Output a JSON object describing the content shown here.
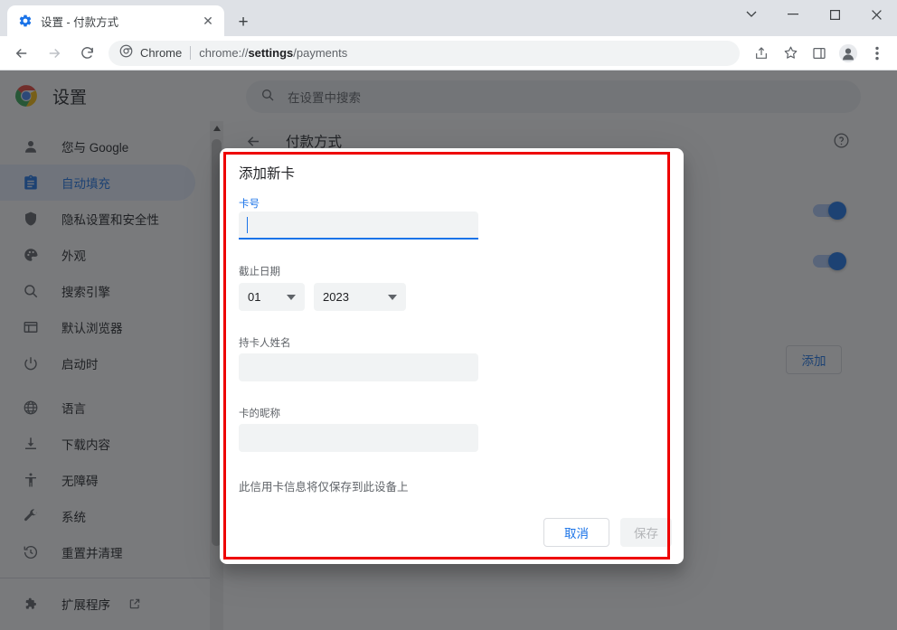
{
  "window": {
    "controls": [
      {
        "name": "tab-search",
        "glyph": "⌄"
      },
      {
        "name": "minimize",
        "glyph": "−"
      },
      {
        "name": "maximize",
        "glyph": "□"
      },
      {
        "name": "close",
        "glyph": "✕"
      }
    ]
  },
  "tab": {
    "title": "设置 - 付款方式",
    "close_glyph": "✕",
    "newtab_glyph": "+"
  },
  "omnibox": {
    "chrome_label": "Chrome",
    "url_prefix": "chrome://",
    "url_bold": "settings",
    "url_suffix": "/payments"
  },
  "settings": {
    "title": "设置",
    "search_placeholder": "在设置中搜索",
    "page_title": "付款方式",
    "add_button": "添加"
  },
  "sidebar": {
    "items": [
      {
        "label": "您与 Google",
        "icon": "person-icon",
        "selected": false
      },
      {
        "label": "自动填充",
        "icon": "clipboard-icon",
        "selected": true
      },
      {
        "label": "隐私设置和安全性",
        "icon": "shield-icon",
        "selected": false
      },
      {
        "label": "外观",
        "icon": "palette-icon",
        "selected": false
      },
      {
        "label": "搜索引擎",
        "icon": "search-icon",
        "selected": false
      },
      {
        "label": "默认浏览器",
        "icon": "browser-icon",
        "selected": false
      },
      {
        "label": "启动时",
        "icon": "power-icon",
        "selected": false
      },
      {
        "label": "语言",
        "icon": "globe-icon",
        "selected": false
      },
      {
        "label": "下载内容",
        "icon": "download-icon",
        "selected": false
      },
      {
        "label": "无障碍",
        "icon": "accessibility-icon",
        "selected": false
      },
      {
        "label": "系统",
        "icon": "wrench-icon",
        "selected": false
      },
      {
        "label": "重置并清理",
        "icon": "restore-icon",
        "selected": false
      }
    ],
    "extensions": {
      "label": "扩展程序",
      "icon": "puzzle-icon",
      "external_icon": "external-link-icon"
    }
  },
  "dialog": {
    "title": "添加新卡",
    "card_number_label": "卡号",
    "card_number_value": "",
    "expiry_label": "截止日期",
    "expiry_month": "01",
    "expiry_year": "2023",
    "name_label": "持卡人姓名",
    "name_value": "",
    "nickname_label": "卡的昵称",
    "nickname_value": "",
    "note": "此信用卡信息将仅保存到此设备上",
    "cancel_label": "取消",
    "save_label": "保存",
    "highlight_color": "#ee0000"
  },
  "colors": {
    "accent": "#1a73e8",
    "selected_nav_bg": "#e8f0fe",
    "field_bg": "#f1f3f4"
  }
}
